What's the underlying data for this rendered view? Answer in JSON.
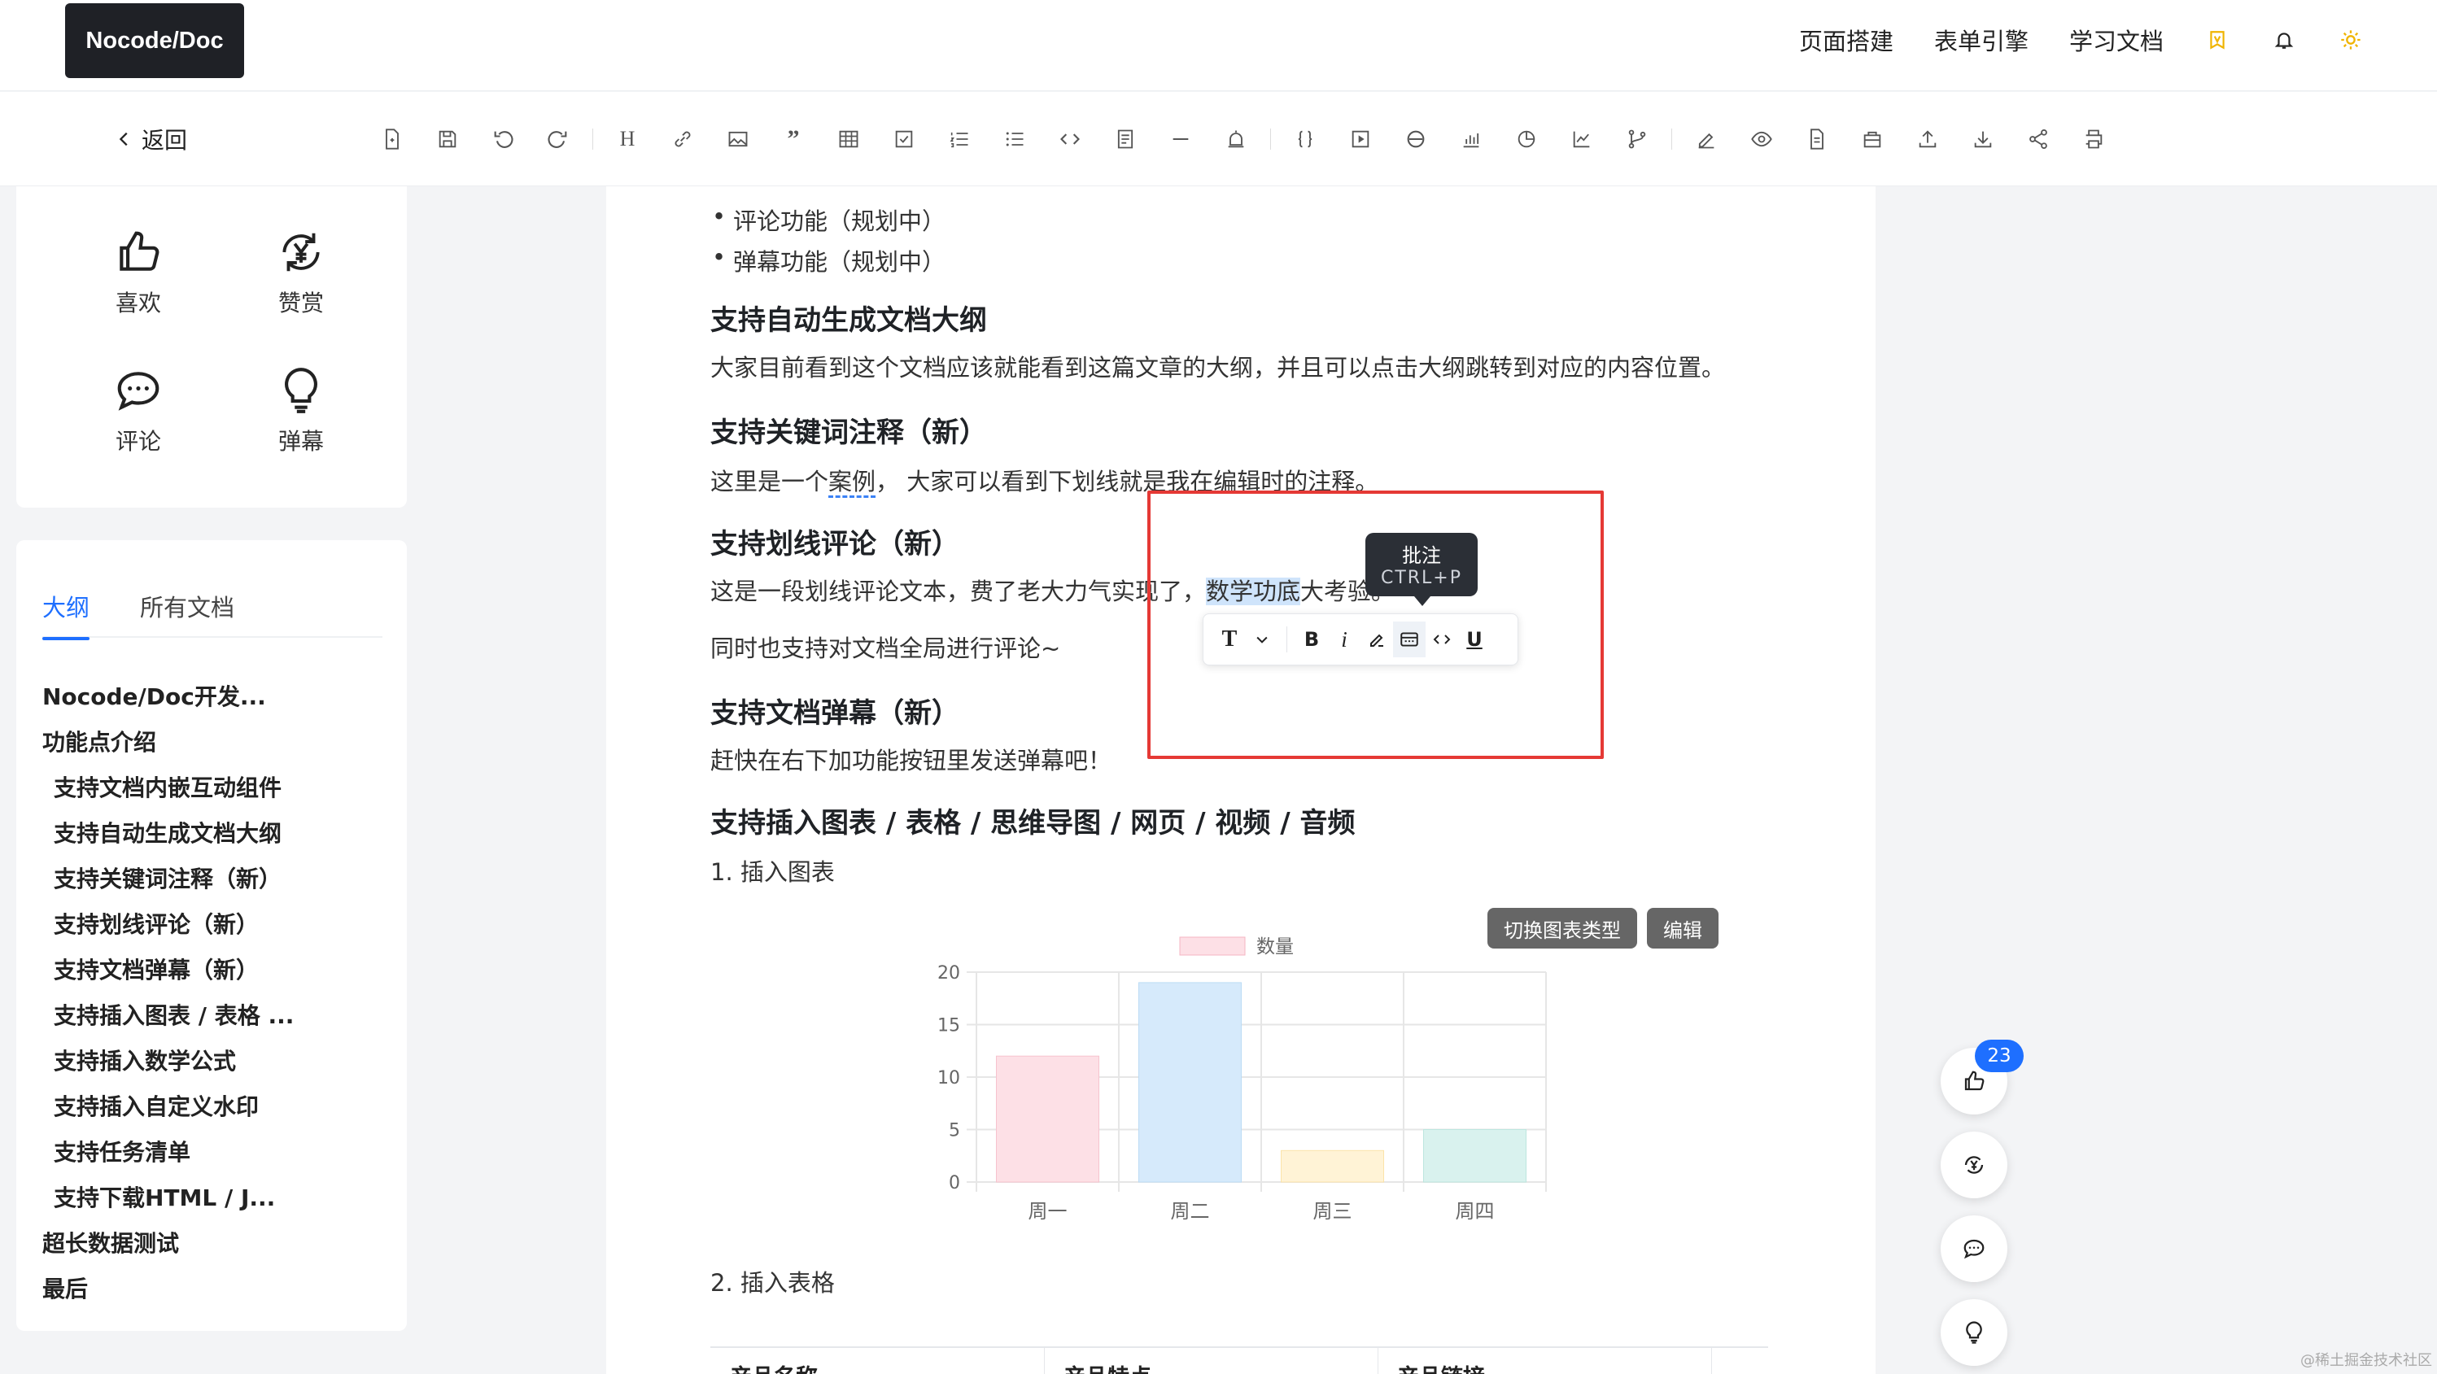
{
  "header": {
    "logo": "Nocode/Doc",
    "nav": [
      "页面搭建",
      "表单引擎",
      "学习文档"
    ]
  },
  "toolbar": {
    "back_label": "返回",
    "heading_label": "H",
    "quote_label": "”"
  },
  "reactions": [
    {
      "label": "喜欢",
      "icon": "thumb-up-icon"
    },
    {
      "label": "赞赏",
      "icon": "yuan-exchange-icon"
    },
    {
      "label": "评论",
      "icon": "comment-icon"
    },
    {
      "label": "弹幕",
      "icon": "bulb-icon"
    }
  ],
  "outline": {
    "tabs": [
      "大纲",
      "所有文档"
    ],
    "items": [
      {
        "label": "Nocode/Doc开发...",
        "level": 1
      },
      {
        "label": "功能点介绍",
        "level": 1
      },
      {
        "label": "支持文档内嵌互动组件",
        "level": 2
      },
      {
        "label": "支持自动生成文档大纲",
        "level": 2
      },
      {
        "label": "支持关键词注释（新）",
        "level": 2
      },
      {
        "label": "支持划线评论（新）",
        "level": 2
      },
      {
        "label": "支持文档弹幕（新）",
        "level": 2
      },
      {
        "label": "支持插入图表 / 表格 ...",
        "level": 2
      },
      {
        "label": "支持插入数学公式",
        "level": 2
      },
      {
        "label": "支持插入自定义水印",
        "level": 2
      },
      {
        "label": "支持任务清单",
        "level": 2
      },
      {
        "label": "支持下载HTML / J...",
        "level": 2
      },
      {
        "label": "超长数据测试",
        "level": 1
      },
      {
        "label": "最后",
        "level": 1
      }
    ]
  },
  "doc": {
    "bullets": [
      "评论功能（规划中）",
      "弹幕功能（规划中）"
    ],
    "h_outline": "支持自动生成文档大纲",
    "p_outline": "大家目前看到这个文档应该就能看到这篇文章的大纲，并且可以点击大纲跳转到对应的内容位置。",
    "h_note": "支持关键词注释（新）",
    "p_note_a": "这里是一个",
    "p_note_word": "案例",
    "p_note_b": "，  大家可以看到下划线就是我在编辑时的注释。",
    "h_comment": "支持划线评论（新）",
    "p_comment_a": "这是一段划线评论文本，费了老大力气实现了，",
    "p_comment_hl": "数学功底",
    "p_comment_b": "大考验。",
    "p_comment2": "同时也支持对文档全局进行评论~",
    "h_danmu": "支持文档弹幕（新）",
    "p_danmu": "赶快在右下加功能按钮里发送弹幕吧！",
    "h_insert": "支持插入图表 / 表格 / 思维导图 / 网页 / 视频 / 音频",
    "p_insert_chart": "1. 插入图表",
    "p_insert_table": "2. 插入表格",
    "chart_switch_btn": "切换图表类型",
    "chart_edit_btn": "编辑",
    "table_headers": [
      "产品名称",
      "产品特点",
      "产品链接"
    ]
  },
  "tooltip": {
    "title": "批注",
    "shortcut": "CTRL+P"
  },
  "float_toolbar": {
    "text_type": "T",
    "bold": "B",
    "italic": "i",
    "underline": "U"
  },
  "right_actions": {
    "like_count": "23"
  },
  "watermark": "@稀土掘金技术社区",
  "chart_data": {
    "type": "bar",
    "categories": [
      "周一",
      "周二",
      "周三",
      "周四"
    ],
    "series": [
      {
        "name": "数量",
        "values": [
          12,
          19,
          3,
          5
        ]
      }
    ],
    "colors": [
      "#fde0e6",
      "#d6eafb",
      "#fff3d6",
      "#d9f2ee"
    ],
    "ylim": [
      0,
      20
    ],
    "yticks": [
      0,
      5,
      10,
      15,
      20
    ],
    "legend": "top"
  },
  "colors": {
    "accent": "#1e6fff",
    "annotation_box": "#e53935"
  }
}
